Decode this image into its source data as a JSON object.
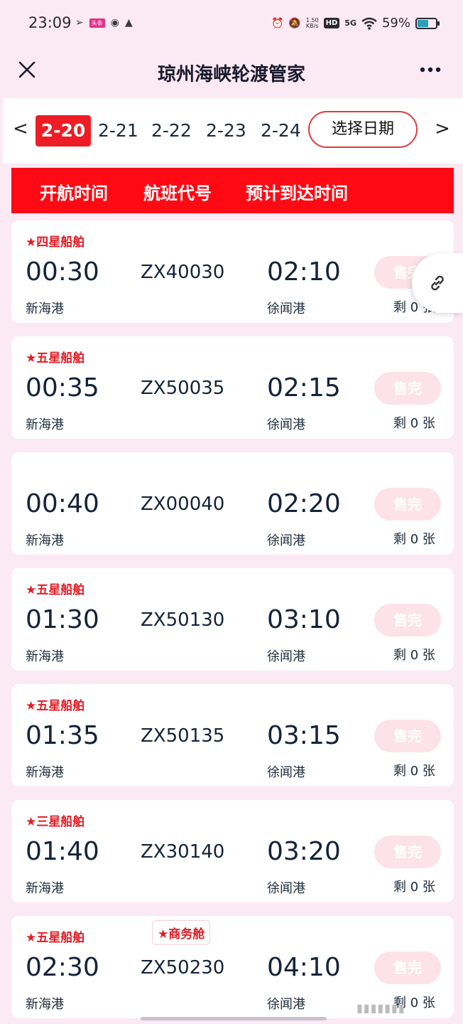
{
  "status_bar": {
    "time": "23:09",
    "app_badge": "头条",
    "net_speed_value": "1.50",
    "net_speed_unit": "KB/s",
    "hd": "HD",
    "signal_label": "5G",
    "battery_pct": "59%",
    "battery_level": 0.59
  },
  "header": {
    "title": "琼州海峡轮渡管家"
  },
  "dates": {
    "prev": "<",
    "next": ">",
    "tabs": [
      "2-20",
      "2-21",
      "2-22",
      "2-23",
      "2-24"
    ],
    "selected": "2-20",
    "pick_label": "选择日期"
  },
  "table_header": {
    "depart": "开航时间",
    "code": "航班代号",
    "arrive": "预计到达时间"
  },
  "sailings": [
    {
      "tag": "★四星船舶",
      "cabin": "",
      "depart": "00:30",
      "code": "ZX40030",
      "arrive": "02:10",
      "from": "新海港",
      "to": "徐闻港",
      "status": "售完",
      "remaining": "剩 0 张"
    },
    {
      "tag": "★五星船舶",
      "cabin": "",
      "depart": "00:35",
      "code": "ZX50035",
      "arrive": "02:15",
      "from": "新海港",
      "to": "徐闻港",
      "status": "售完",
      "remaining": "剩 0 张"
    },
    {
      "tag": "",
      "cabin": "",
      "depart": "00:40",
      "code": "ZX00040",
      "arrive": "02:20",
      "from": "新海港",
      "to": "徐闻港",
      "status": "售完",
      "remaining": "剩 0 张"
    },
    {
      "tag": "★五星船舶",
      "cabin": "",
      "depart": "01:30",
      "code": "ZX50130",
      "arrive": "03:10",
      "from": "新海港",
      "to": "徐闻港",
      "status": "售完",
      "remaining": "剩 0 张"
    },
    {
      "tag": "★五星船舶",
      "cabin": "",
      "depart": "01:35",
      "code": "ZX50135",
      "arrive": "03:15",
      "from": "新海港",
      "to": "徐闻港",
      "status": "售完",
      "remaining": "剩 0 张"
    },
    {
      "tag": "★三星船舶",
      "cabin": "",
      "depart": "01:40",
      "code": "ZX30140",
      "arrive": "03:20",
      "from": "新海港",
      "to": "徐闻港",
      "status": "售完",
      "remaining": "剩 0 张"
    },
    {
      "tag": "★五星船舶",
      "cabin": "★商务舱",
      "depart": "02:30",
      "code": "ZX50230",
      "arrive": "04:10",
      "from": "新海港",
      "to": "徐闻港",
      "status": "售完",
      "remaining": "剩 0 张"
    }
  ],
  "colors": {
    "accent": "#ee1c24",
    "header_bg": "#ff0a14",
    "page_bg": "#fbe9f3",
    "sold_out_bg": "#fde2ea"
  },
  "icons": {
    "close": "close-icon",
    "more": "more-icon",
    "link": "link-icon"
  }
}
